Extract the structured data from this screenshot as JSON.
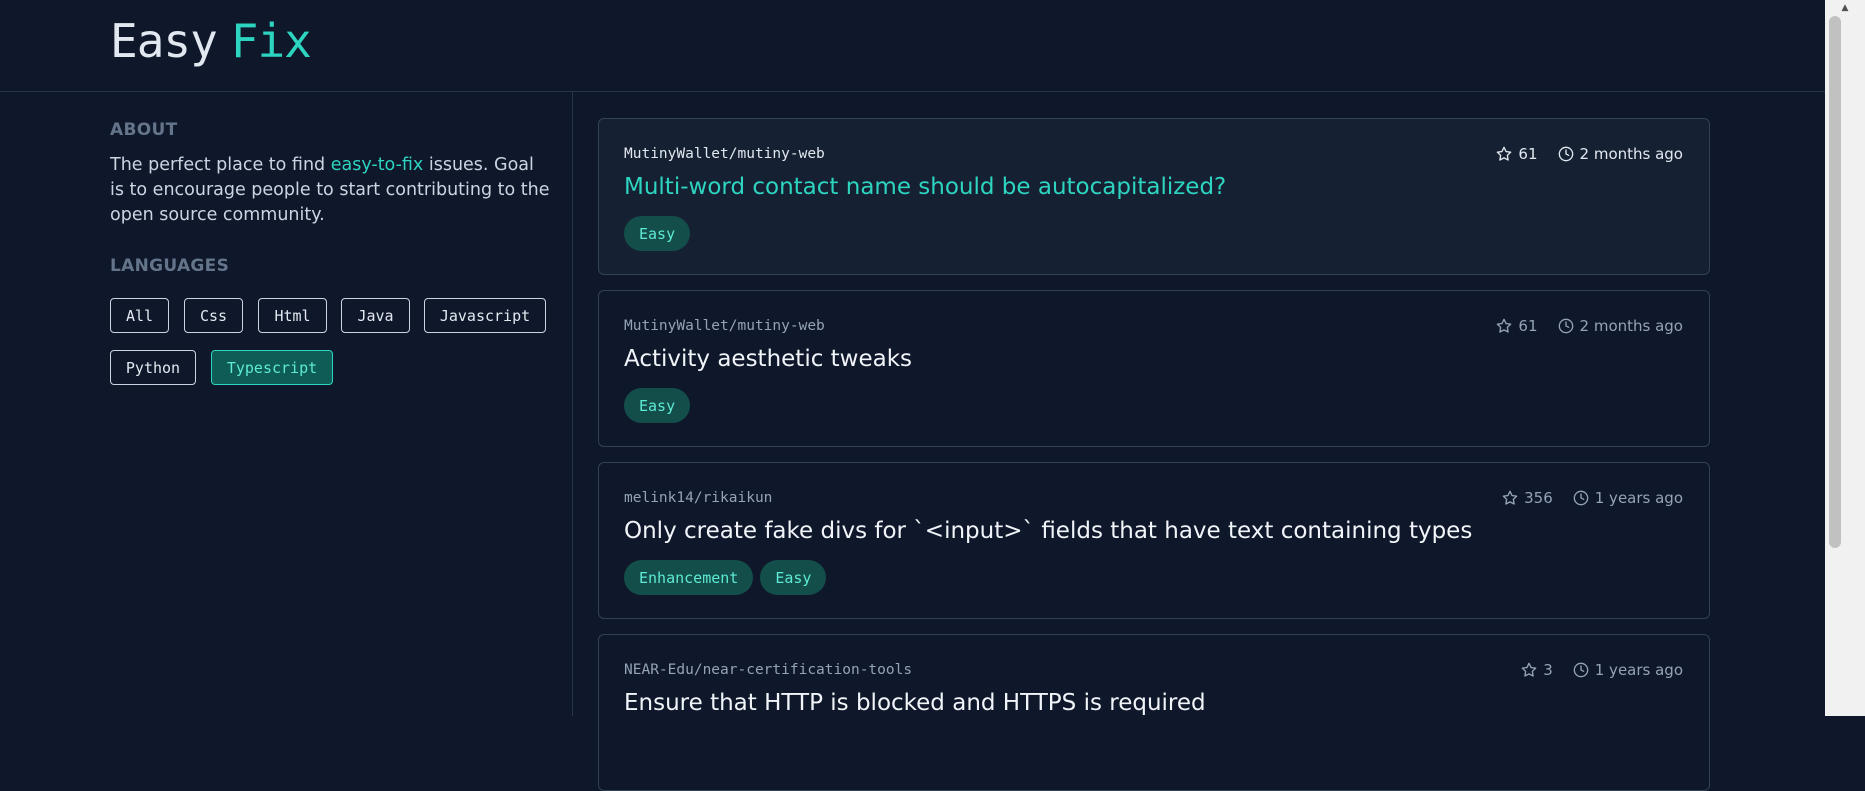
{
  "header": {
    "logo_part1": "Easy",
    "logo_part2": "Fix"
  },
  "sidebar": {
    "about_title": "ABOUT",
    "about_pre": "The perfect place to find ",
    "about_link": "easy-to-fix",
    "about_post": " issues. Goal is to encourage people to start contributing to the open source community.",
    "languages_title": "LANGUAGES",
    "languages": [
      "All",
      "Css",
      "Html",
      "Java",
      "Javascript",
      "Python",
      "Typescript"
    ],
    "active_language": "Typescript"
  },
  "issues": [
    {
      "repo": "MutinyWallet/mutiny-web",
      "stars": "61",
      "age": "2 months ago",
      "title": "Multi-word contact name should be autocapitalized?",
      "tags": [
        "Easy"
      ]
    },
    {
      "repo": "MutinyWallet/mutiny-web",
      "stars": "61",
      "age": "2 months ago",
      "title": "Activity aesthetic tweaks",
      "tags": [
        "Easy"
      ]
    },
    {
      "repo": "melink14/rikaikun",
      "stars": "356",
      "age": "1 years ago",
      "title": "Only create fake divs for `<input>` fields that have text containing types",
      "tags": [
        "Enhancement",
        "Easy"
      ]
    },
    {
      "repo": "NEAR-Edu/near-certification-tools",
      "stars": "3",
      "age": "1 years ago",
      "title": "Ensure that HTTP is blocked and HTTPS is required",
      "tags": []
    }
  ],
  "colors": {
    "accent": "#2dd4bf",
    "background": "#0f172a",
    "tag_bg": "#134e4a"
  },
  "icons": {
    "stars": "star-icon",
    "age": "clock-icon"
  }
}
